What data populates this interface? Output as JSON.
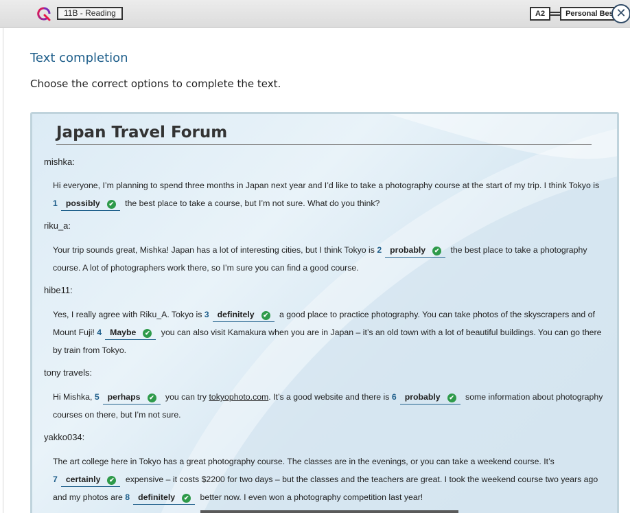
{
  "header": {
    "unit": "11B - Reading",
    "level": "A2",
    "course": "Personal Best",
    "close_glyph": "✕",
    "colors": {
      "accent": "#1f5f8b",
      "check": "#2e9a4a"
    }
  },
  "section_title": "Text completion",
  "instructions": "Choose the correct options to complete the text.",
  "forum": {
    "title": "Japan Travel Forum",
    "posts": [
      {
        "user": "mishka:",
        "segments": [
          {
            "t": "Hi everyone, I’m planning to spend three months in Japan next year and I’d like to take a photography course at the start of my trip. I think Tokyo is "
          },
          {
            "num": "1",
            "answer": "possibly"
          },
          {
            "t": " the best place to take a course, but I’m not sure. What do you think?"
          }
        ]
      },
      {
        "user": "riku_a:",
        "segments": [
          {
            "t": "Your trip sounds great, Mishka! Japan has a lot of interesting cities, but I think Tokyo is "
          },
          {
            "num": "2",
            "answer": "probably"
          },
          {
            "t": " the best place to take a photography course. A lot of photographers work there, so I’m sure you can find a good course."
          }
        ]
      },
      {
        "user": "hibe11:",
        "segments": [
          {
            "t": "Yes, I really agree with Riku_A. Tokyo is "
          },
          {
            "num": "3",
            "answer": "definitely"
          },
          {
            "t": " a good place to practice photography. You can take photos of the skyscrapers and of Mount Fuji! "
          },
          {
            "num": "4",
            "answer": "Maybe"
          },
          {
            "t": " you can also visit Kamakura when you are in Japan – it’s an old town with a lot of beautiful buildings. You can go there by train from Tokyo."
          }
        ]
      },
      {
        "user": "tony travels:",
        "segments": [
          {
            "t": "Hi Mishka, "
          },
          {
            "num": "5",
            "answer": "perhaps"
          },
          {
            "t": " you can try "
          },
          {
            "link": "tokyophoto.com"
          },
          {
            "t": ". It’s a good website and there is "
          },
          {
            "num": "6",
            "answer": "probably"
          },
          {
            "t": " some information about photography courses on there, but I’m not sure."
          }
        ]
      },
      {
        "user": "yakko034:",
        "segments": [
          {
            "t": "The art college here in Tokyo has a great photography course. The classes are in the evenings, or you can take a weekend course. It’s "
          },
          {
            "num": "7",
            "answer": "certainly"
          },
          {
            "t": " expensive – it costs $2200 for two days – but the classes and the teachers are great. I took the weekend course two years ago and my photos are "
          },
          {
            "num": "8",
            "answer": "definitely"
          },
          {
            "t": " better now. I even won a photography competition last year!"
          }
        ]
      }
    ]
  }
}
